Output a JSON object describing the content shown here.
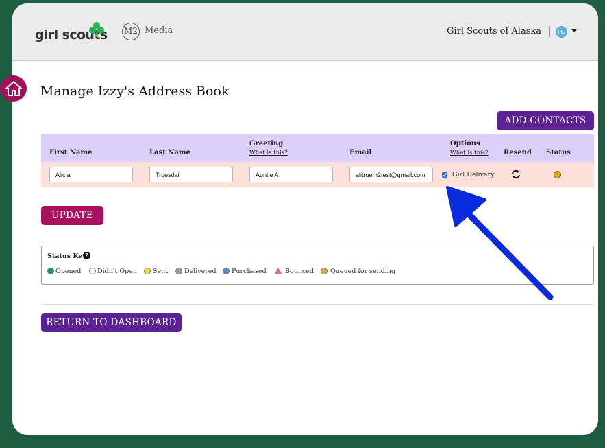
{
  "header": {
    "brand": "girl scouts",
    "partner_monogram": "M2",
    "partner_name": "Media",
    "council": "Girl Scouts of Alaska",
    "avatar_initials": "PG"
  },
  "page": {
    "title": "Manage Izzy's Address Book"
  },
  "buttons": {
    "add_contacts": "ADD CONTACTS",
    "update": "UPDATE",
    "return_dashboard": "RETURN TO DASHBOARD"
  },
  "table": {
    "columns": {
      "first_name": "First Name",
      "last_name": "Last Name",
      "greeting": "Greeting",
      "greeting_help": "What is this?",
      "email": "Email",
      "options": "Options",
      "options_help": "What is this?",
      "resend": "Resend",
      "status": "Status"
    },
    "rows": [
      {
        "first_name": "Alicia",
        "last_name": "Truesdail",
        "greeting": "Auntie A",
        "email": "alitruem2test@gmail.com",
        "option_label": "Girl Delivery",
        "option_checked": true,
        "status_color": "#d8ae2c"
      }
    ]
  },
  "status_key": {
    "title": "Status Key",
    "help_icon": "question-circle-icon",
    "items": [
      {
        "label": "Opened",
        "color": "#1a9a54"
      },
      {
        "label": "Didn't Open",
        "color": "#ffffff"
      },
      {
        "label": "Sent",
        "color": "#f4e23a"
      },
      {
        "label": "Delivered",
        "color": "#9a9a9a"
      },
      {
        "label": "Purchased",
        "color": "#4a90d9"
      },
      {
        "label": "Bounced",
        "color": "#e56a7a"
      },
      {
        "label": "Queued for sending",
        "color": "#d8ae2c"
      }
    ]
  },
  "colors": {
    "background": "#1e5d3f",
    "purple": "#5d2196",
    "magenta": "#a8115f",
    "table_header": "#dccffa",
    "table_row": "#fde0da",
    "annotation_arrow": "#0a2bdc"
  }
}
